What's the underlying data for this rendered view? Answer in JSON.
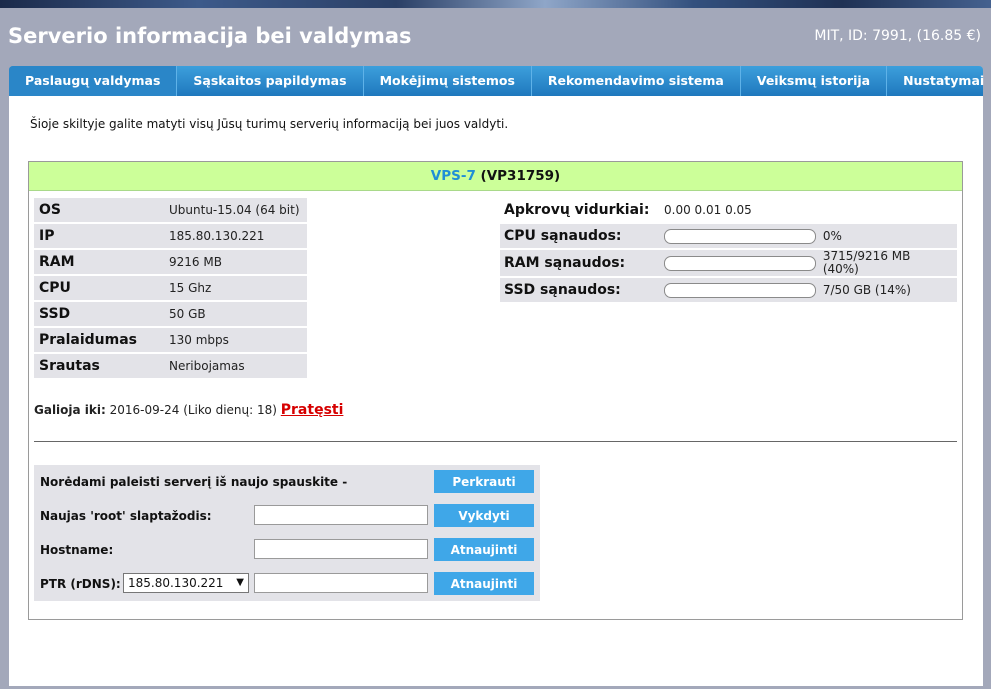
{
  "header": {
    "title": "Serverio informacija bei valdymas",
    "account": "MIT, ID: 7991, (16.85 €)"
  },
  "tabs": [
    {
      "label": "Paslaugų valdymas",
      "active": true
    },
    {
      "label": "Sąskaitos papildymas"
    },
    {
      "label": "Mokėjimų sistemos"
    },
    {
      "label": "Rekomendavimo sistema"
    },
    {
      "label": "Veiksmų istorija"
    },
    {
      "label": "Nustatymai"
    }
  ],
  "intro": "Šioje skiltyje galite matyti visų Jūsų turimų serverių informaciją bei juos valdyti.",
  "server": {
    "name": "VPS-7",
    "code": "(VP31759)",
    "specs": [
      {
        "label": "OS",
        "value": "Ubuntu-15.04 (64 bit)"
      },
      {
        "label": "IP",
        "value": "185.80.130.221"
      },
      {
        "label": "RAM",
        "value": "9216 MB"
      },
      {
        "label": "CPU",
        "value": "15 Ghz"
      },
      {
        "label": "SSD",
        "value": "50 GB"
      },
      {
        "label": "Pralaidumas",
        "value": "130 mbps"
      },
      {
        "label": "Srautas",
        "value": "Neribojamas"
      }
    ],
    "load": {
      "label": "Apkrovų vidurkiai:",
      "value": "0.00 0.01 0.05"
    },
    "usage": [
      {
        "label": "CPU sąnaudos:",
        "percent": 0,
        "text": "0%"
      },
      {
        "label": "RAM sąnaudos:",
        "percent": 40,
        "text": "3715/9216 MB (40%)"
      },
      {
        "label": "SSD sąnaudos:",
        "percent": 14,
        "text": "7/50 GB (14%)"
      }
    ],
    "expiry": {
      "label": "Galioja iki:",
      "value": "2016-09-24 (Liko dienų: 18)",
      "renew": "Pratęsti"
    }
  },
  "actions": {
    "reboot": {
      "label": "Norėdami paleisti serverį iš naujo spauskite -",
      "button": "Perkrauti"
    },
    "root_password": {
      "label": "Naujas 'root' slaptažodis:",
      "value": "",
      "button": "Vykdyti"
    },
    "hostname": {
      "label": "Hostname:",
      "value": "",
      "button": "Atnaujinti"
    },
    "ptr": {
      "label": "PTR (rDNS):",
      "selected_ip": "185.80.130.221",
      "value": "",
      "button": "Atnaujinti"
    }
  },
  "colors": {
    "accent": "#2a86c8",
    "header_bg": "#a3a8ba",
    "panel_head": "#ccff99",
    "usage_bar": "#f7a10a",
    "link": "#d60000"
  }
}
